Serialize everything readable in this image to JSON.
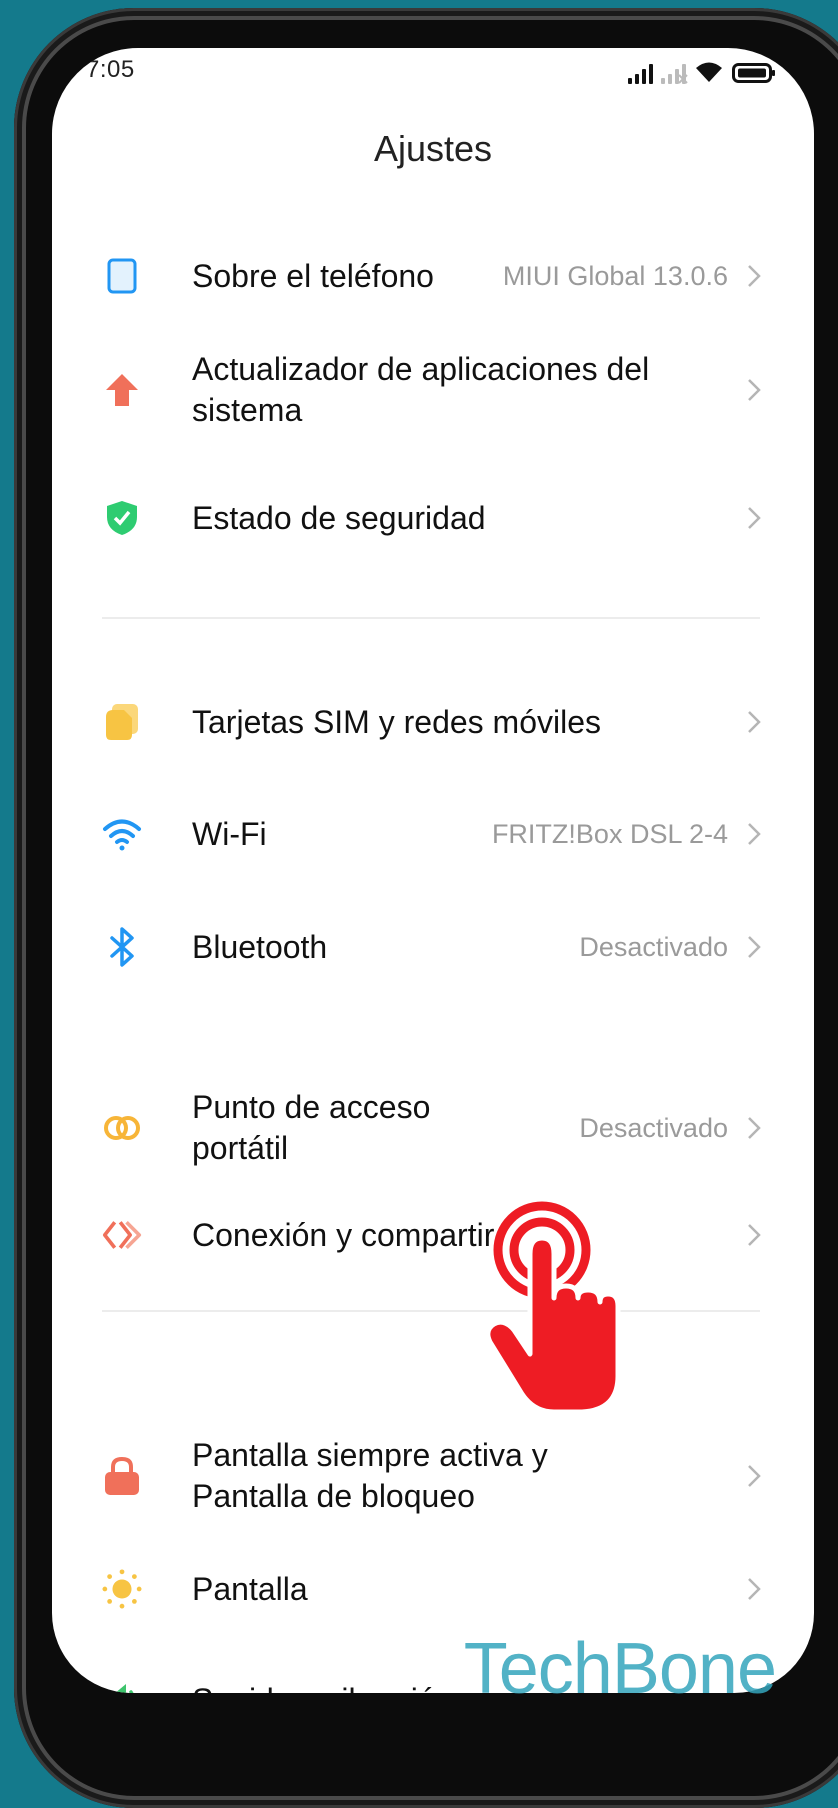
{
  "status_bar": {
    "time": "7:05",
    "icons": [
      "signal-icon",
      "signal-weak-icon",
      "wifi-icon",
      "battery-icon"
    ]
  },
  "header": {
    "title": "Ajustes"
  },
  "settings": {
    "group1": [
      {
        "icon": "phone-icon",
        "label": "Sobre el teléfono",
        "value": "MIUI Global 13.0.6",
        "icon_color": "#2196f3"
      },
      {
        "icon": "arrow-up-icon",
        "label": "Actualizador de aplicaciones del sistema",
        "value": "",
        "icon_color": "#f0705a"
      },
      {
        "icon": "shield-icon",
        "label": "Estado de seguridad",
        "value": "",
        "icon_color": "#2ecc71"
      }
    ],
    "group2": [
      {
        "icon": "sim-card-icon",
        "label": "Tarjetas SIM y redes móviles",
        "value": "",
        "icon_color": "#f7c443"
      },
      {
        "icon": "wifi-icon",
        "label": "Wi-Fi",
        "value": "FRITZ!Box DSL 2-4",
        "icon_color": "#2196f3"
      },
      {
        "icon": "bluetooth-icon",
        "label": "Bluetooth",
        "value": "Desactivado",
        "icon_color": "#2196f3"
      },
      {
        "icon": "hotspot-icon",
        "label": "Punto de acceso portátil",
        "value": "Desactivado",
        "icon_color": "#f7b538"
      },
      {
        "icon": "connection-sharing-icon",
        "label": "Conexión y compartir",
        "value": "",
        "icon_color": "#f0705a"
      }
    ],
    "group3": [
      {
        "icon": "lock-icon",
        "label": "Pantalla siempre activa y Pantalla de bloqueo",
        "value": "",
        "icon_color": "#f0705a"
      },
      {
        "icon": "sun-icon",
        "label": "Pantalla",
        "value": "",
        "icon_color": "#f7c443"
      },
      {
        "icon": "speaker-icon",
        "label": "Sonido y vibración",
        "value": "",
        "icon_color": "#3ec46d"
      }
    ]
  },
  "overlay": {
    "tap_indicator": "hand-pointer-icon",
    "watermark": "TechBone"
  },
  "colors": {
    "background": "#147a8c",
    "accent_red": "#ee1c24",
    "watermark": "#34a5bd"
  }
}
